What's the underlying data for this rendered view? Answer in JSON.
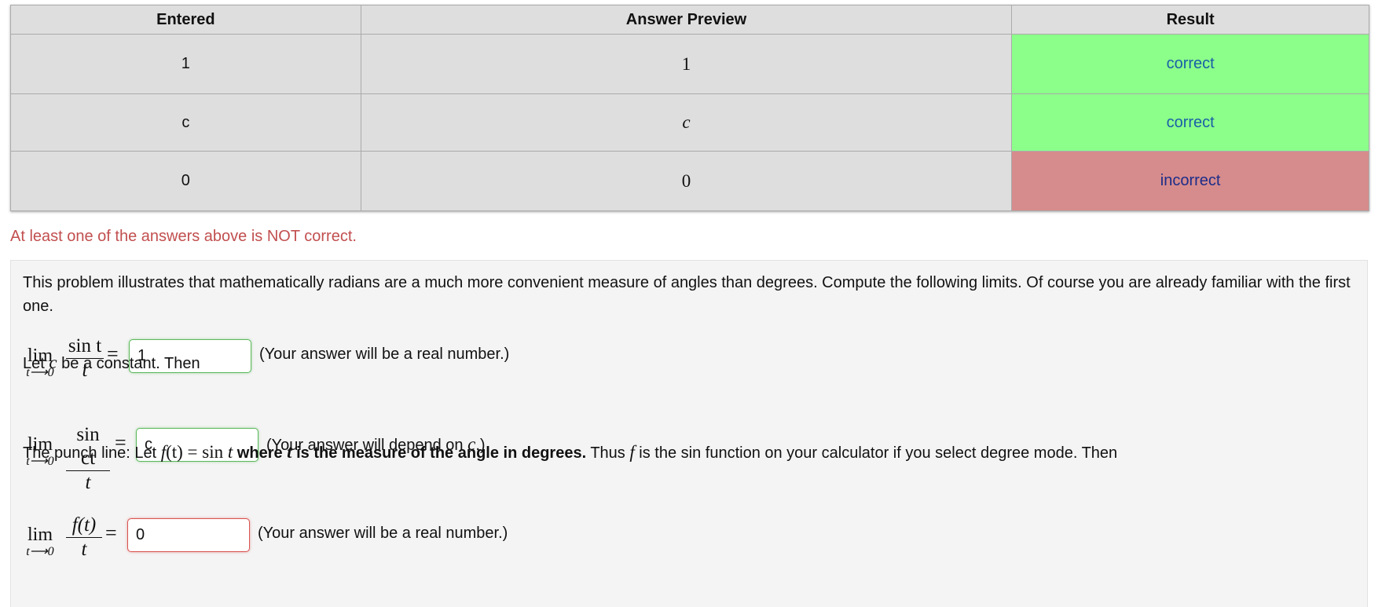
{
  "table": {
    "headers": [
      "Entered",
      "Answer Preview",
      "Result"
    ],
    "rows": [
      {
        "entered": "1",
        "preview": "1",
        "result": "correct"
      },
      {
        "entered": "c",
        "preview": "c",
        "result": "correct"
      },
      {
        "entered": "0",
        "preview": "0",
        "result": "incorrect"
      }
    ]
  },
  "summary": "At least one of the answers above is NOT correct.",
  "problem": {
    "intro": "This problem illustrates that mathematically radians are a much more convenient measure of angles than degrees. Compute the following limits. Of course you are already familiar with the first one.",
    "parts": [
      {
        "lim_word": "lim",
        "lim_sub": "t⟶0",
        "numerator": "sin t",
        "denominator": "t",
        "equals": "=",
        "answer": "1",
        "hint": "(Your answer will be a real number.)"
      },
      {
        "lim_word": "lim",
        "lim_sub": "t⟶0",
        "numerator": "sin ct",
        "denominator": "t",
        "equals": "=",
        "answer": "c",
        "hint_pre": "(Your answer will depend on ",
        "hint_var": "c",
        "hint_post": ".)"
      },
      {
        "lim_word": "lim",
        "lim_sub": "t⟶0",
        "numerator": "f(t)",
        "denominator": "t",
        "equals": "=",
        "answer": "0",
        "hint": "(Your answer will be a real number.)"
      }
    ],
    "let_c": {
      "pre": "Let ",
      "var": "c",
      "post": " be a constant. Then"
    },
    "punch": {
      "pre": "The punch line: Let ",
      "f": "f",
      "paren_t": "(t)",
      "eq": " = sin ",
      "t1": "t",
      "bold1": " where ",
      "t2": "t",
      "bold2": " is the measure of the angle in degrees.",
      "mid": " Thus ",
      "f2": "f",
      "post": " is the sin function on your calculator if you select degree mode. Then"
    }
  },
  "colors": {
    "correct_bg": "#8cff8a",
    "incorrect_bg": "#d68c8c",
    "summary_text": "#c24f4f"
  }
}
